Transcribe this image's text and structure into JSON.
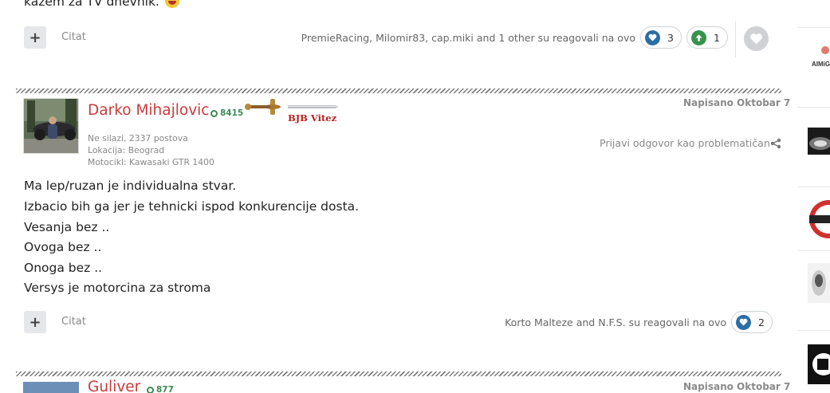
{
  "previous_post": {
    "last_line": "kažem za TV dnevnik.",
    "multiquote_label": "+",
    "quote_label": "Citat",
    "reacted_text": "PremieRacing, Milomir83, cap.miki and 1 other su reagovali na ovo",
    "reactions": [
      {
        "icon": "heart-icon",
        "count": "3"
      },
      {
        "icon": "upvote-icon",
        "count": "1"
      }
    ]
  },
  "post": {
    "author": "Darko Mihajlovic",
    "reputation": "8415",
    "rank_badge": "BJB Vitez",
    "posted": "Napisano Oktobar 7",
    "meta": [
      "Ne silazi, 2337 postova",
      "Lokacija: Beograd",
      "Motocikl: Kawasaki GTR 1400"
    ],
    "report_label": "Prijavi odgovor kao problematičan",
    "body": [
      "Ma lep/ruzan je individualna stvar.",
      "Izbacio bih ga jer je tehnicki ispod konkurencije dosta.",
      "Vesanja bez ..",
      "Ovoga bez ..",
      "Onoga bez ..",
      "Versys je motorcina za stroma"
    ],
    "multiquote_label": "+",
    "quote_label": "Citat",
    "reacted_text": "Korto Malteze and N.F.S. su reagovali na ovo",
    "reaction_count": "2"
  },
  "next_post": {
    "author": "Guliver",
    "reputation": "877",
    "posted": "Napisano Oktobar 7"
  },
  "sidebar": {
    "ad_text": "AIMiG"
  },
  "colors": {
    "author": "#c93b3b",
    "reputation": "#3c8b55",
    "heart": "#2b6ea6",
    "upvote": "#37924c"
  }
}
